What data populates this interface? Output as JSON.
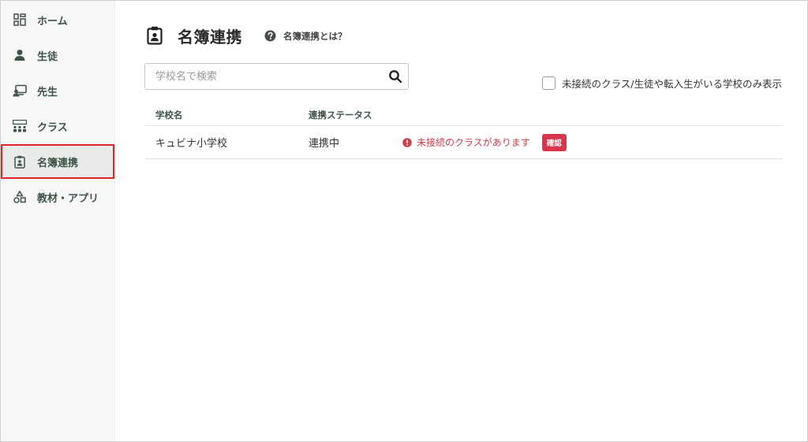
{
  "sidebar": {
    "items": [
      {
        "label": "ホーム",
        "icon": "dashboard-icon",
        "active": false
      },
      {
        "label": "生徒",
        "icon": "person-icon",
        "active": false
      },
      {
        "label": "先生",
        "icon": "teacher-icon",
        "active": false
      },
      {
        "label": "クラス",
        "icon": "class-icon",
        "active": false
      },
      {
        "label": "名簿連携",
        "icon": "clipboard-badge-icon",
        "active": true
      },
      {
        "label": "教材・アプリ",
        "icon": "shapes-icon",
        "active": false
      }
    ]
  },
  "header": {
    "title": "名簿連携",
    "help_label": "名簿連携とは？"
  },
  "search": {
    "placeholder": "学校名で検索",
    "value": ""
  },
  "filter": {
    "label": "未接続のクラス/生徒や転入生がいる学校のみ表示",
    "checked": false
  },
  "table": {
    "headers": [
      "学校名",
      "連携ステータス"
    ],
    "rows": [
      {
        "school": "キュビナ小学校",
        "status": "連携中",
        "warning": "未接続のクラスがあります",
        "action": "確認"
      }
    ]
  },
  "colors": {
    "sidebar_text": "#3d5446",
    "active_outline": "#e0242c",
    "warning": "#c9404e",
    "confirm_button": "#d9364b"
  }
}
